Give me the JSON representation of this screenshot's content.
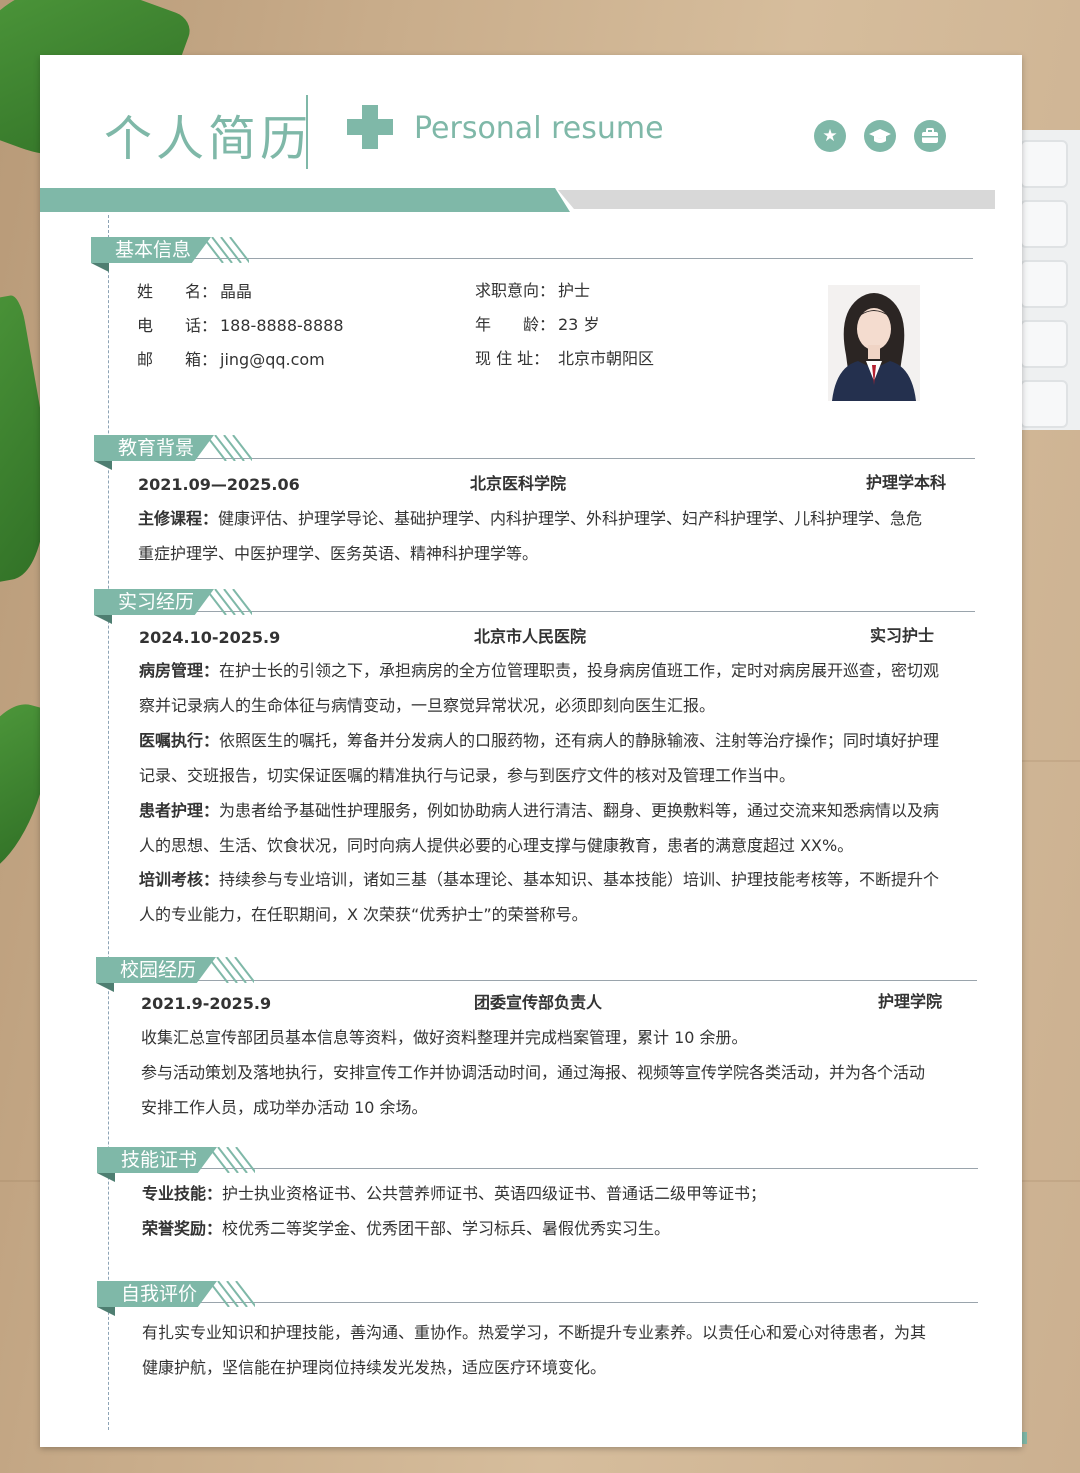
{
  "header": {
    "title_cn": "个人简历",
    "title_en": "Personal resume",
    "icons": [
      "star-icon",
      "graduation-cap-icon",
      "briefcase-icon"
    ]
  },
  "colors": {
    "accent": "#7fb8a8",
    "accent_dark": "#4e7e71",
    "gray_band": "#d8d8d8",
    "text": "#333333"
  },
  "basic": {
    "heading": "基本信息",
    "name_label": "姓　　名：",
    "name": "晶晶",
    "phone_label": "电　　话：",
    "phone": "188-8888-8888",
    "email_label": "邮　　箱：",
    "email": "jing@qq.com",
    "intent_label": "求职意向：",
    "intent": "护士",
    "age_label": "年　　龄：",
    "age": "23 岁",
    "address_label": "现 住 址：",
    "address": "北京市朝阳区"
  },
  "education": {
    "heading": "教育背景",
    "period": "2021.09—2025.06",
    "school": "北京医科学院",
    "degree": "护理学本科",
    "course_label": "主修课程：",
    "course_line1": "健康评估、护理学导论、基础护理学、内科护理学、外科护理学、妇产科护理学、儿科护理学、急危",
    "course_line2": "重症护理学、中医护理学、医务英语、精神科护理学等。"
  },
  "internship": {
    "heading": "实习经历",
    "period": "2024.10-2025.9",
    "org": "北京市人民医院",
    "role": "实习护士",
    "items": [
      {
        "label": "病房管理：",
        "line1": "在护士长的引领之下，承担病房的全方位管理职责，投身病房值班工作，定时对病房展开巡查，密切观",
        "line2": "察并记录病人的生命体征与病情变动，一旦察觉异常状况，必须即刻向医生汇报。"
      },
      {
        "label": "医嘱执行：",
        "line1": "依照医生的嘱托，筹备并分发病人的口服药物，还有病人的静脉输液、注射等治疗操作；同时填好护理",
        "line2": "记录、交班报告，切实保证医嘱的精准执行与记录，参与到医疗文件的核对及管理工作当中。"
      },
      {
        "label": "患者护理：",
        "line1": "为患者给予基础性护理服务，例如协助病人进行清洁、翻身、更换敷料等，通过交流来知悉病情以及病",
        "line2": "人的思想、生活、饮食状况，同时向病人提供必要的心理支撑与健康教育，患者的满意度超过 XX%。"
      },
      {
        "label": "培训考核：",
        "line1": "持续参与专业培训，诸如三基（基本理论、基本知识、基本技能）培训、护理技能考核等，不断提升个",
        "line2": "人的专业能力，在任职期间，X 次荣获“优秀护士”的荣誉称号。"
      }
    ]
  },
  "campus": {
    "heading": "校园经历",
    "period": "2021.9-2025.9",
    "role": "团委宣传部负责人",
    "org": "护理学院",
    "line1": "收集汇总宣传部团员基本信息等资料，做好资料整理并完成档案管理，累计 10 余册。",
    "line2": "参与活动策划及落地执行，安排宣传工作并协调活动时间，通过海报、视频等宣传学院各类活动，并为各个活动",
    "line3": "安排工作人员，成功举办活动 10 余场。"
  },
  "skills": {
    "heading": "技能证书",
    "skill_label": "专业技能：",
    "skill_text": "护士执业资格证书、公共营养师证书、英语四级证书、普通话二级甲等证书；",
    "award_label": "荣誉奖励：",
    "award_text": "校优秀二等奖学金、优秀团干部、学习标兵、暑假优秀实习生。"
  },
  "self": {
    "heading": "自我评价",
    "line1": "有扎实专业知识和护理技能，善沟通、重协作。热爱学习，不断提升专业素养。以责任心和爱心对待患者，为其",
    "line2": "健康护航，坚信能在护理岗位持续发光发热，适应医疗环境变化。"
  }
}
